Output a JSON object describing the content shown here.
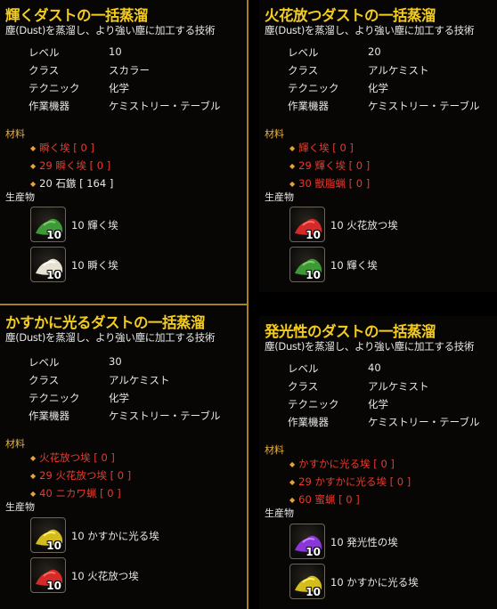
{
  "panels": [
    {
      "title": "輝くダストの一括蒸溜",
      "description": "塵(Dust)を蒸溜し、より強い塵に加工する技術",
      "info": [
        {
          "label": "レベル",
          "value": "10"
        },
        {
          "label": "クラス",
          "value": "スカラー"
        },
        {
          "label": "テクニック",
          "value": "化学"
        },
        {
          "label": "作業機器",
          "value": "ケミストリー・テーブル"
        }
      ],
      "materials_heading": "材料",
      "materials": [
        {
          "text": "瞬く埃 [ 0 ]",
          "color": "#e83a2e"
        },
        {
          "text": "29 瞬く埃 [ 0 ]",
          "color": "#e83a2e"
        },
        {
          "text": "20 石鏃 [ 164 ]",
          "color": "#e6e6e6"
        }
      ],
      "products_heading": "生産物",
      "products": [
        {
          "icon": "green-dust-icon",
          "color": "#3e9a36",
          "quantity": "10",
          "label": "10 輝く埃"
        },
        {
          "icon": "white-dust-icon",
          "color": "#e8e2d4",
          "quantity": "10",
          "label": "10 瞬く埃"
        }
      ]
    },
    {
      "title": "火花放つダストの一括蒸溜",
      "description": "塵(Dust)を蒸溜し、より強い塵に加工する技術",
      "info": [
        {
          "label": "レベル",
          "value": "20"
        },
        {
          "label": "クラス",
          "value": "アルケミスト"
        },
        {
          "label": "テクニック",
          "value": "化学"
        },
        {
          "label": "作業機器",
          "value": "ケミストリー・テーブル"
        }
      ],
      "materials_heading": "材料",
      "materials": [
        {
          "text": "輝く埃 [ 0 ]",
          "color": "#e83a2e"
        },
        {
          "text": "29 輝く埃 [ 0 ]",
          "color": "#e83a2e"
        },
        {
          "text": "30 獣脂蝋 [ 0 ]",
          "color": "#e83a2e"
        }
      ],
      "products_heading": "生産物",
      "products": [
        {
          "icon": "red-dust-icon",
          "color": "#d42a2a",
          "quantity": "10",
          "label": "10 火花放つ埃"
        },
        {
          "icon": "green-dust-icon",
          "color": "#3e9a36",
          "quantity": "10",
          "label": "10 輝く埃"
        }
      ]
    },
    {
      "title": "かすかに光るダストの一括蒸溜",
      "description": "塵(Dust)を蒸溜し、より強い塵に加工する技術",
      "info": [
        {
          "label": "レベル",
          "value": "30"
        },
        {
          "label": "クラス",
          "value": "アルケミスト"
        },
        {
          "label": "テクニック",
          "value": "化学"
        },
        {
          "label": "作業機器",
          "value": "ケミストリー・テーブル"
        }
      ],
      "materials_heading": "材料",
      "materials": [
        {
          "text": "火花放つ埃 [ 0 ]",
          "color": "#e83a2e"
        },
        {
          "text": "29 火花放つ埃 [ 0 ]",
          "color": "#e83a2e"
        },
        {
          "text": "40 ニカワ蝋 [ 0 ]",
          "color": "#e83a2e"
        }
      ],
      "products_heading": "生産物",
      "products": [
        {
          "icon": "yellow-dust-icon",
          "color": "#d4bc1c",
          "quantity": "10",
          "label": "10 かすかに光る埃"
        },
        {
          "icon": "red-dust-icon",
          "color": "#d42a2a",
          "quantity": "10",
          "label": "10 火花放つ埃"
        }
      ]
    },
    {
      "title": "発光性のダストの一括蒸溜",
      "description": "塵(Dust)を蒸溜し、より強い塵に加工する技術",
      "info": [
        {
          "label": "レベル",
          "value": "40"
        },
        {
          "label": "クラス",
          "value": "アルケミスト"
        },
        {
          "label": "テクニック",
          "value": "化学"
        },
        {
          "label": "作業機器",
          "value": "ケミストリー・テーブル"
        }
      ],
      "materials_heading": "材料",
      "materials": [
        {
          "text": "かすかに光る埃 [ 0 ]",
          "color": "#e83a2e"
        },
        {
          "text": "29 かすかに光る埃 [ 0 ]",
          "color": "#e83a2e"
        },
        {
          "text": "60 蜜蝋 [ 0 ]",
          "color": "#e83a2e"
        }
      ],
      "products_heading": "生産物",
      "products": [
        {
          "icon": "purple-dust-icon",
          "color": "#8a36d8",
          "quantity": "10",
          "label": "10 発光性の埃"
        },
        {
          "icon": "yellow-dust-icon",
          "color": "#d4bc1c",
          "quantity": "10",
          "label": "10 かすかに光る埃"
        }
      ]
    }
  ]
}
